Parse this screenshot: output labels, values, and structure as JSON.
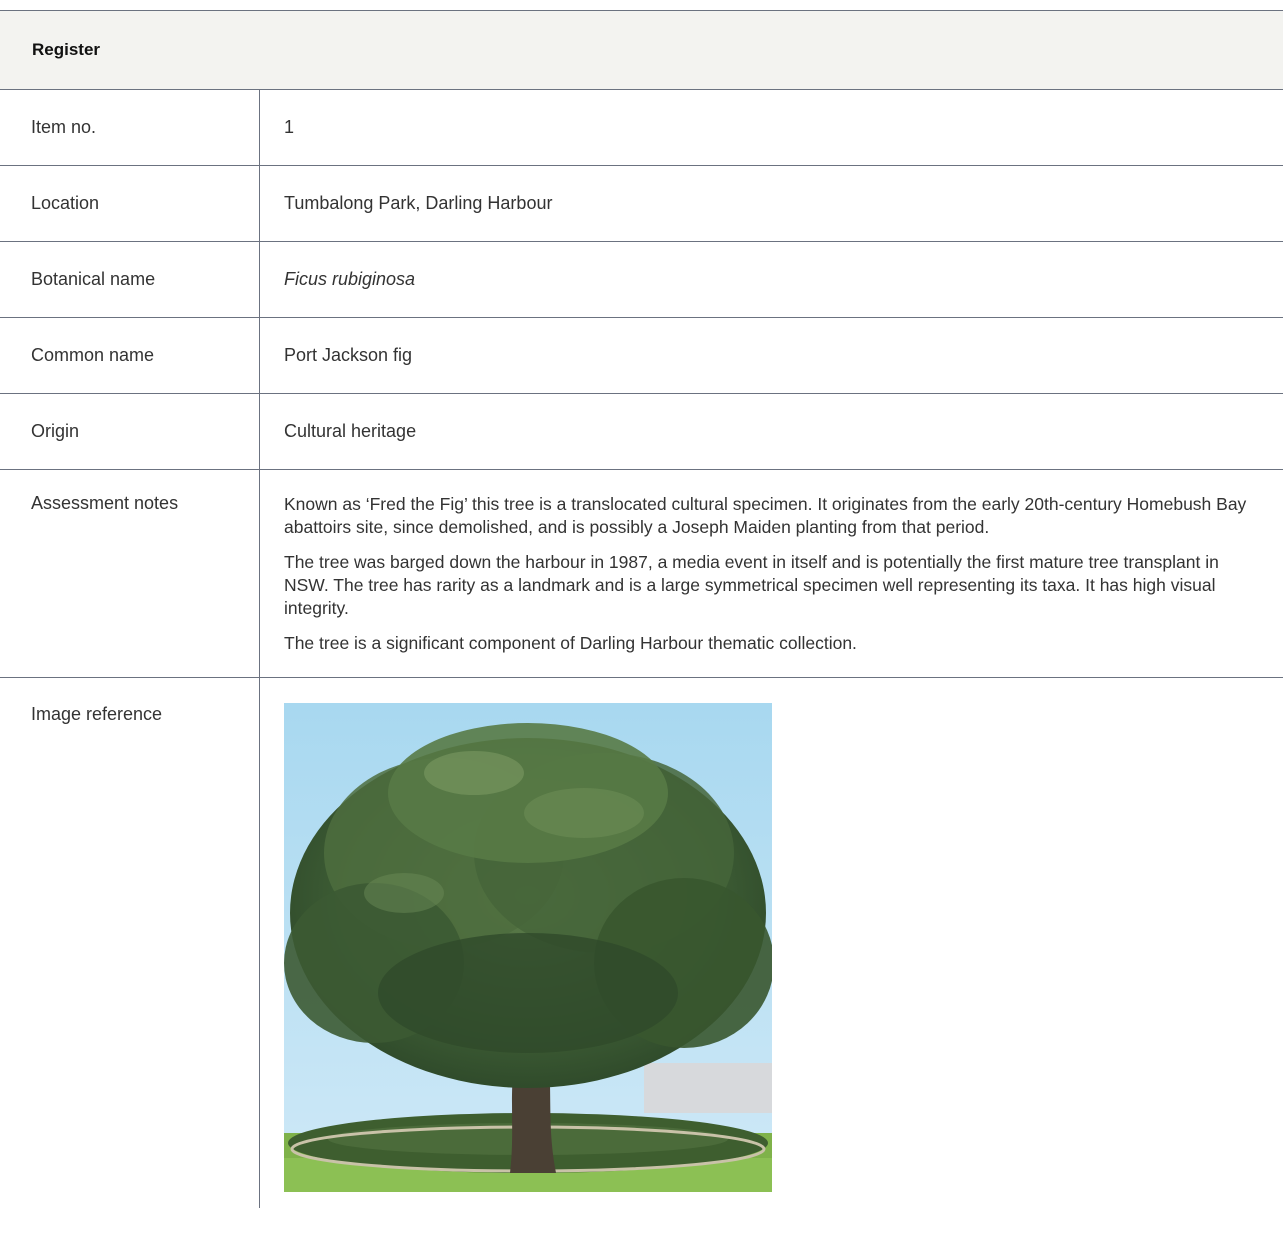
{
  "register": {
    "title": "Register",
    "rows": [
      {
        "label": "Item no.",
        "value": "1"
      },
      {
        "label": "Location",
        "value": "Tumbalong Park, Darling Harbour"
      },
      {
        "label": "Botanical name",
        "value": "Ficus rubiginosa"
      },
      {
        "label": "Common name",
        "value": "Port Jackson fig"
      },
      {
        "label": "Origin",
        "value": "Cultural heritage"
      }
    ],
    "assessment": {
      "label": "Assessment notes",
      "paragraphs": [
        "Known as ‘Fred the Fig’ this tree is a translocated cultural specimen. It originates from the early 20th-century Homebush Bay abattoirs site, since demolished, and is possibly a Joseph Maiden planting from that period.",
        "The tree was barged down the harbour in 1987, a media event in itself and is potentially the first mature tree transplant in NSW. The tree has rarity as a landmark and is a large symmetrical specimen well representing its taxa. It has high visual integrity.",
        "The tree is a significant component of Darling Harbour thematic collection."
      ]
    },
    "image": {
      "label": "Image reference",
      "alt": "Port Jackson fig tree in park"
    }
  },
  "colors": {
    "header_bg": "#f3f3f0",
    "rule": "#6b7280",
    "text": "#333333"
  }
}
